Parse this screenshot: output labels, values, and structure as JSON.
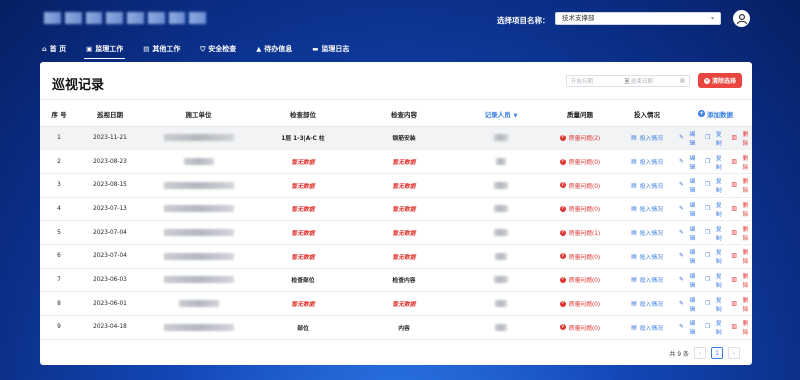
{
  "header": {
    "project_label": "选择项目名称：",
    "project_value": "技术支撑部"
  },
  "nav": [
    {
      "label": "首 页",
      "icon": "home-icon",
      "glyph": "⌂"
    },
    {
      "label": "监理工作",
      "icon": "clipboard-icon",
      "glyph": "▣"
    },
    {
      "label": "其他工作",
      "icon": "list-icon",
      "glyph": "▤"
    },
    {
      "label": "安全检查",
      "icon": "shield-icon",
      "glyph": "⛉"
    },
    {
      "label": "待办信息",
      "icon": "warning-icon",
      "glyph": "▲"
    },
    {
      "label": "监理日志",
      "icon": "folder-icon",
      "glyph": "▬"
    }
  ],
  "page": {
    "title": "巡视记录",
    "date_start_placeholder": "开始日期",
    "date_sep": "至",
    "date_end_placeholder": "结束日期",
    "clear_label": "清除选择"
  },
  "table": {
    "headers": {
      "index": "序 号",
      "date": "巡视日期",
      "unit": "施工单位",
      "part": "检查部位",
      "content": "检查内容",
      "recorder": "记录人员",
      "quality": "质量问题",
      "invest": "投入情况",
      "add": "添加数据"
    },
    "ops": {
      "edit": "编 辑",
      "copy": "复 制",
      "delete": "删 除"
    },
    "rows": [
      {
        "no": "1",
        "date": "2023-11-21",
        "part": "1层 1-3|A-C 柱",
        "content": "钢筋安装",
        "quality": "质量问题(2)",
        "invest": "投入情况",
        "no_data_part": false,
        "no_data_content": false
      },
      {
        "no": "2",
        "date": "2023-08-23",
        "part": "暂无数据",
        "content": "暂无数据",
        "quality": "质量问题(0)",
        "invest": "投入情况",
        "no_data_part": true,
        "no_data_content": true
      },
      {
        "no": "3",
        "date": "2023-08-15",
        "part": "暂无数据",
        "content": "暂无数据",
        "quality": "质量问题(0)",
        "invest": "投入情况",
        "no_data_part": true,
        "no_data_content": true
      },
      {
        "no": "4",
        "date": "2023-07-13",
        "part": "暂无数据",
        "content": "暂无数据",
        "quality": "质量问题(0)",
        "invest": "投入情况",
        "no_data_part": true,
        "no_data_content": true
      },
      {
        "no": "5",
        "date": "2023-07-04",
        "part": "暂无数据",
        "content": "暂无数据",
        "quality": "质量问题(1)",
        "invest": "投入情况",
        "no_data_part": true,
        "no_data_content": true
      },
      {
        "no": "6",
        "date": "2023-07-04",
        "part": "暂无数据",
        "content": "暂无数据",
        "quality": "质量问题(0)",
        "invest": "投入情况",
        "no_data_part": true,
        "no_data_content": true
      },
      {
        "no": "7",
        "date": "2023-06-03",
        "part": "检查部位",
        "content": "检查内容",
        "quality": "质量问题(0)",
        "invest": "投入情况",
        "no_data_part": false,
        "no_data_content": false
      },
      {
        "no": "8",
        "date": "2023-06-01",
        "part": "暂无数据",
        "content": "暂无数据",
        "quality": "质量问题(0)",
        "invest": "投入情况",
        "no_data_part": true,
        "no_data_content": true
      },
      {
        "no": "9",
        "date": "2023-04-18",
        "part": "部位",
        "content": "内容",
        "quality": "质量问题(0)",
        "invest": "投入情况",
        "no_data_part": false,
        "no_data_content": false
      }
    ]
  },
  "pagination": {
    "total_text": "共 9 条",
    "current_page": "1"
  },
  "colors": {
    "accent": "#3a7ce0",
    "danger": "#e0342f",
    "header_bg": "#0a2e86"
  }
}
